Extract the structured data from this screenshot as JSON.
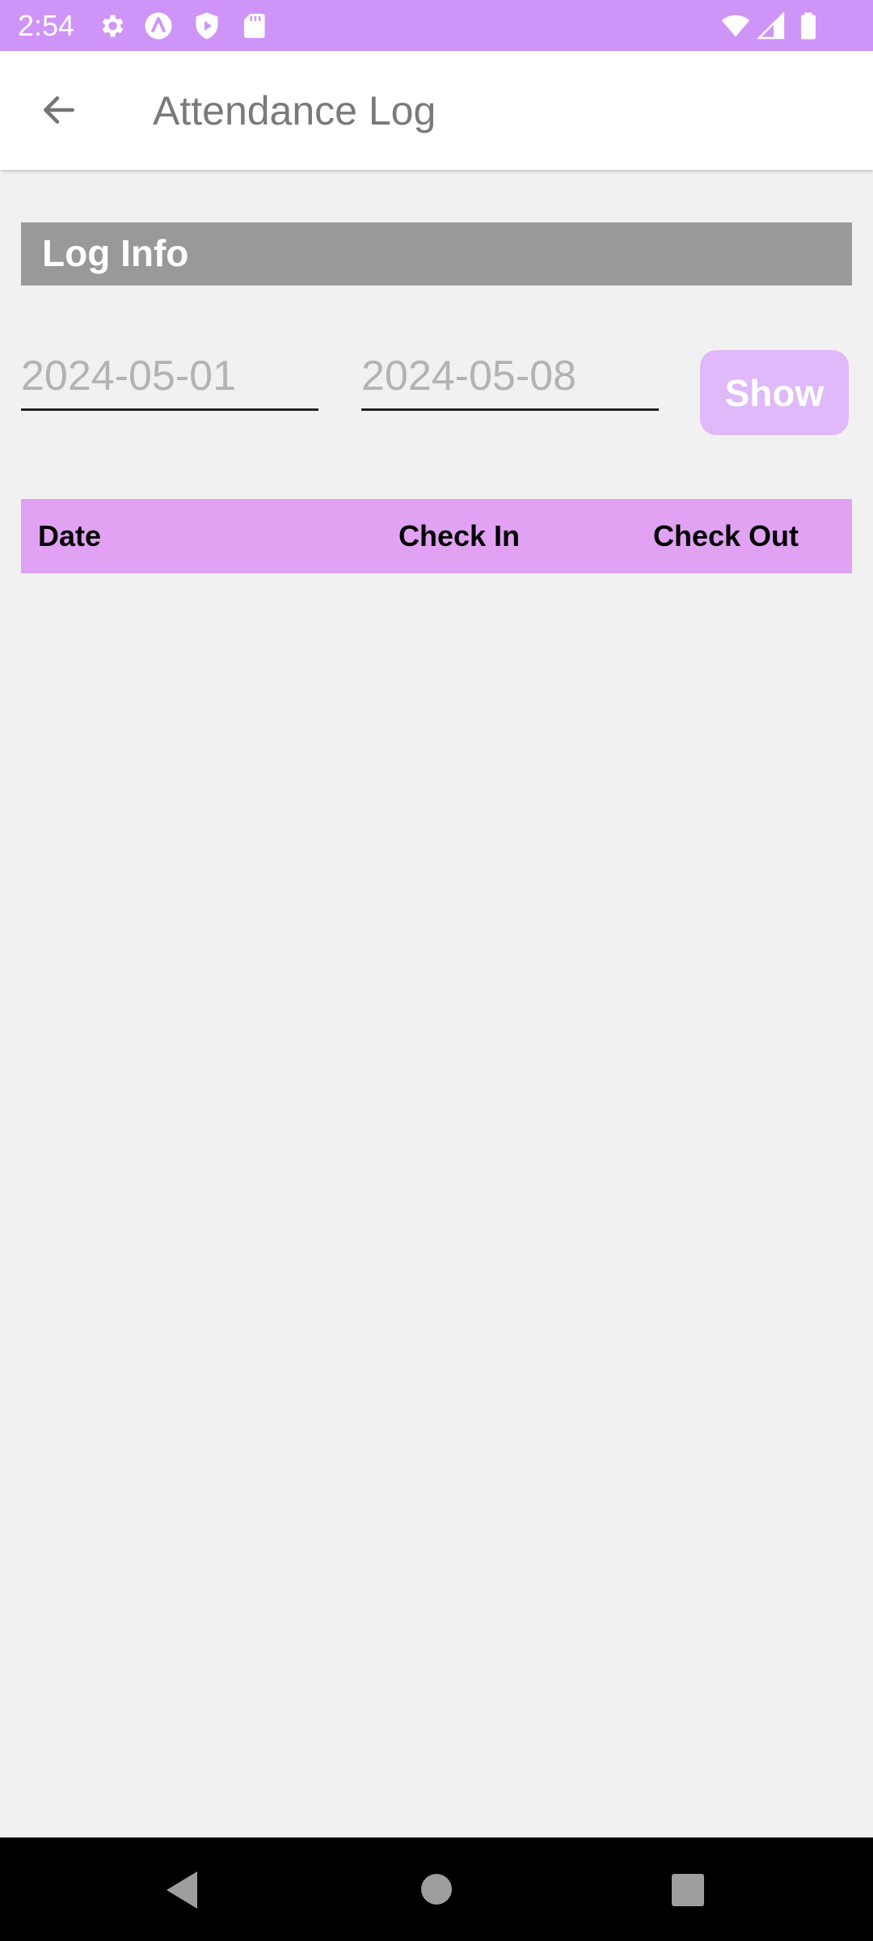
{
  "status_bar": {
    "time": "2:54",
    "background": "#cf94f7",
    "icons": [
      "gear-icon",
      "a-circle-icon",
      "shield-play-icon",
      "sd-card-icon",
      "wifi-icon",
      "signal-icon",
      "battery-icon"
    ]
  },
  "app_bar": {
    "title": "Attendance Log",
    "back_icon": "arrow-left-icon"
  },
  "section": {
    "title": "Log Info",
    "background": "#999999"
  },
  "filters": {
    "start_date": "2024-05-01",
    "end_date": "2024-05-08",
    "show_label": "Show",
    "button_color": "#dfb9f9"
  },
  "table": {
    "header_color": "#e1a2f3",
    "columns": [
      "Date",
      "Check In",
      "Check Out"
    ],
    "rows": []
  },
  "nav_bar": {
    "icons": [
      "back-triangle-icon",
      "home-circle-icon",
      "recents-square-icon"
    ]
  }
}
